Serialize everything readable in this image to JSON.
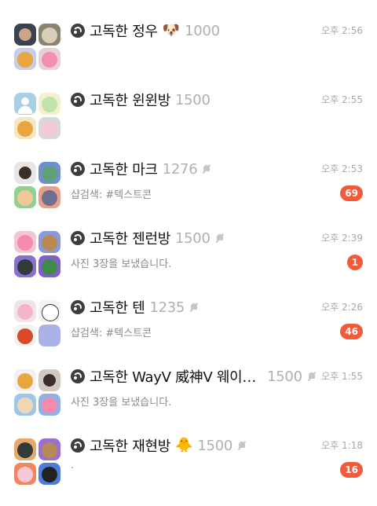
{
  "rooms": [
    {
      "name": "고독한 정우",
      "emoji": "🐶",
      "member_count": "1000",
      "muted": false,
      "time": "오후 2:56",
      "preview": "",
      "unread": "",
      "avatars": [
        "photo-boy",
        "photo-cat",
        "kakao-ryan",
        "kakao-apeach"
      ]
    },
    {
      "name": "고독한 윈윈방",
      "emoji": "",
      "member_count": "1500",
      "muted": false,
      "time": "오후 2:55",
      "preview": "",
      "unread": "",
      "avatars": [
        "default-person",
        "kakao-muzi",
        "kakao-ryan",
        "kakao-apeach-white"
      ]
    },
    {
      "name": "고독한 마크",
      "emoji": "",
      "member_count": "1276",
      "muted": true,
      "time": "오후 2:53",
      "preview": "샵검색: #텍스트콘",
      "unread": "69",
      "avatars": [
        "photo-boy",
        "photo-dino",
        "kakao-cone-bear",
        "photo-pink"
      ]
    },
    {
      "name": "고독한 젠런방",
      "emoji": "",
      "member_count": "1500",
      "muted": true,
      "time": "오후 2:39",
      "preview": "사진 3장을 보냈습니다.",
      "unread": "1",
      "avatars": [
        "kakao-apeach",
        "kakao-frodo",
        "kakao-jay-g",
        "kakao-frodo-green"
      ]
    },
    {
      "name": "고독한 텐",
      "emoji": "",
      "member_count": "1235",
      "muted": true,
      "time": "오후 2:26",
      "preview": "샵검색: #텍스트콘",
      "unread": "46",
      "avatars": [
        "kakao-pink-face",
        "kakao-white-dog",
        "photo-red",
        "blank-lavender"
      ]
    },
    {
      "name": "고독한 WayV 威神V 웨이…",
      "emoji": "",
      "member_count": "1500",
      "muted": true,
      "time": "오후 1:55",
      "preview": "사진 3장을 보냈습니다.",
      "unread": "",
      "avatars": [
        "kakao-ryan",
        "photo-boy",
        "kakao-cone-face",
        "kakao-apeach"
      ]
    },
    {
      "name": "고독한 재현방",
      "emoji": "🐥",
      "member_count": "1500",
      "muted": true,
      "time": "오후 1:18",
      "preview": "·",
      "unread": "16",
      "avatars": [
        "kakao-jay-g",
        "kakao-frodo-purple",
        "kakao-apeach-heart",
        "kakao-muzi-black"
      ]
    }
  ],
  "colors": {
    "badge": "#f25a3a",
    "time": "#a8a8a8",
    "preview": "#8a8a8a",
    "member_count": "#b0b0b0"
  }
}
